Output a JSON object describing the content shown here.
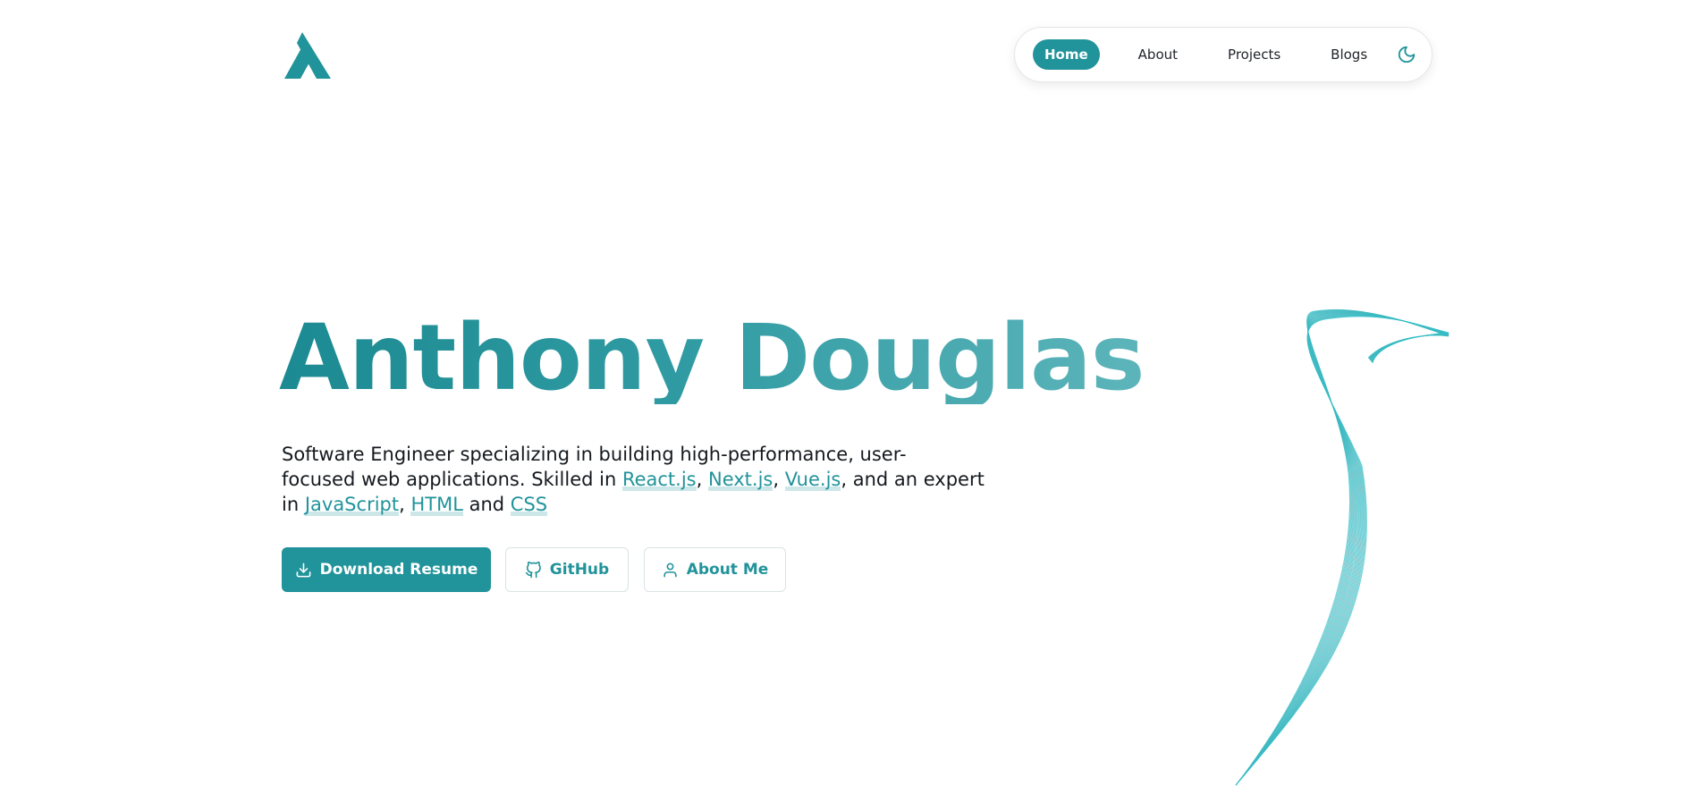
{
  "colors": {
    "accent": "#21939a",
    "gradient_start": "#1c8a92",
    "gradient_end": "#5cb5ba",
    "text": "#15191e"
  },
  "header": {
    "logo_icon": "stylized-a-logo",
    "nav": {
      "items": [
        {
          "label": "Home",
          "active": true
        },
        {
          "label": "About",
          "active": false
        },
        {
          "label": "Projects",
          "active": false
        },
        {
          "label": "Blogs",
          "active": false
        }
      ],
      "theme_toggle_icon": "moon-icon"
    }
  },
  "hero": {
    "title": "Anthony Douglas",
    "description": {
      "line1": "Software Engineer specializing in building high-performance, user-",
      "line2_text": "focused web applications. Skilled in ",
      "sep_comma": ",",
      "line2_tail": ", and an expert",
      "line3_text": "in ",
      "and_text": " and ",
      "tech": {
        "react": "React.js",
        "next": "Next.js",
        "vue": "Vue.js",
        "javascript": "JavaScript",
        "html": "HTML",
        "css": "CSS"
      }
    },
    "buttons": {
      "download": {
        "label": "Download Resume",
        "icon": "download-icon"
      },
      "github": {
        "label": "GitHub",
        "icon": "github-icon"
      },
      "about": {
        "label": "About Me",
        "icon": "user-icon"
      }
    }
  }
}
